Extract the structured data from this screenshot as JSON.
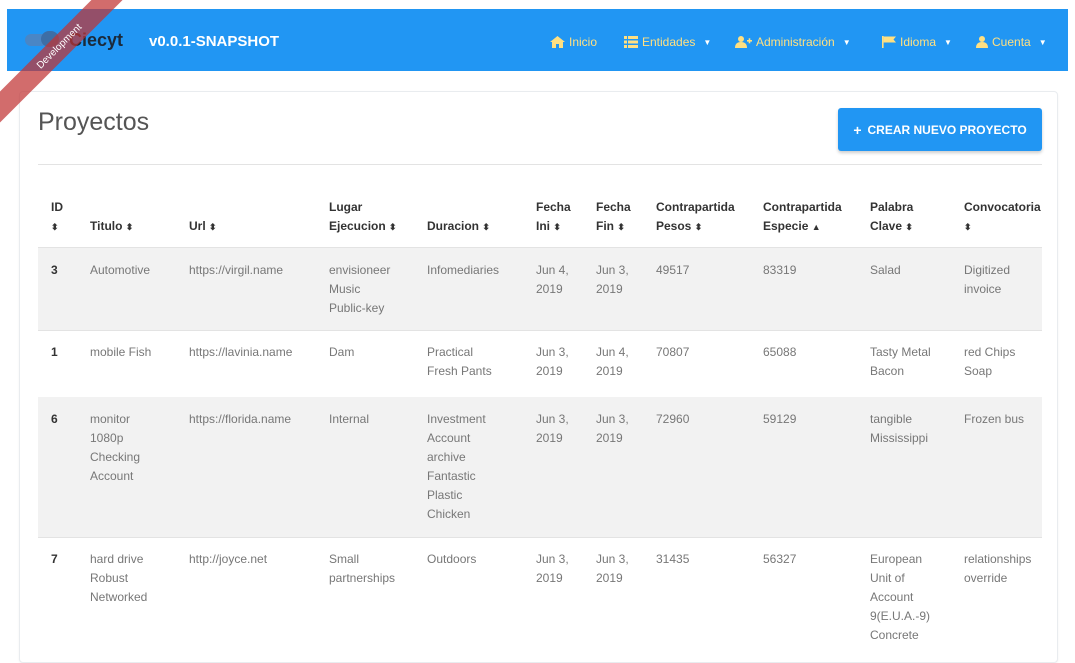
{
  "app": {
    "brand_name": "Ciecyt",
    "version": "v0.0.1-SNAPSHOT",
    "ribbon": "Development"
  },
  "nav": [
    {
      "label": "Inicio",
      "icon": "home-icon"
    },
    {
      "label": "Entidades",
      "icon": "list-icon"
    },
    {
      "label": "Administración",
      "icon": "user-add-icon"
    },
    {
      "label": "Idioma",
      "icon": "flag-icon"
    },
    {
      "label": "Cuenta",
      "icon": "user-icon"
    }
  ],
  "page": {
    "title": "Proyectos",
    "create_button": "CREAR NUEVO PROYECTO"
  },
  "table": {
    "headers": [
      {
        "l1": "ID",
        "l2": ""
      },
      {
        "l1": "Titulo",
        "l2": ""
      },
      {
        "l1": "Url",
        "l2": ""
      },
      {
        "l1": "Lugar",
        "l2": "Ejecucion"
      },
      {
        "l1": "Duracion",
        "l2": ""
      },
      {
        "l1": "Fecha",
        "l2": "Ini"
      },
      {
        "l1": "Fecha",
        "l2": "Fin"
      },
      {
        "l1": "Contrapartida",
        "l2": "Pesos"
      },
      {
        "l1": "Contrapartida",
        "l2": "Especie"
      },
      {
        "l1": "Palabra",
        "l2": "Clave"
      },
      {
        "l1": "Convocatoria",
        "l2": ""
      }
    ],
    "rows": [
      {
        "id": "3",
        "titulo": "Automotive",
        "url": "https://virgil.name",
        "lugar": "envisioneer\nMusic\nPublic-key",
        "duracion": "Infomediaries",
        "fecha_ini": "Jun 4,\n2019",
        "fecha_fin": "Jun 3,\n2019",
        "pesos": "49517",
        "especie": "83319",
        "clave": "Salad",
        "convocatoria": "Digitized\ninvoice"
      },
      {
        "id": "1",
        "titulo": "mobile Fish",
        "url": "https://lavinia.name",
        "lugar": "Dam",
        "duracion": "Practical\nFresh Pants",
        "fecha_ini": "Jun 3,\n2019",
        "fecha_fin": "Jun 4,\n2019",
        "pesos": "70807",
        "especie": "65088",
        "clave": "Tasty Metal\nBacon",
        "convocatoria": "red Chips\nSoap"
      },
      {
        "id": "6",
        "titulo": "monitor\n1080p\nChecking\nAccount",
        "url": "https://florida.name",
        "lugar": "Internal",
        "duracion": "Investment\nAccount\narchive\nFantastic\nPlastic\nChicken",
        "fecha_ini": "Jun 3,\n2019",
        "fecha_fin": "Jun 3,\n2019",
        "pesos": "72960",
        "especie": "59129",
        "clave": "tangible\nMississippi",
        "convocatoria": "Frozen bus"
      },
      {
        "id": "7",
        "titulo": "hard drive\nRobust\nNetworked",
        "url": "http://joyce.net",
        "lugar": "Small\npartnerships",
        "duracion": "Outdoors",
        "fecha_ini": "Jun 3,\n2019",
        "fecha_fin": "Jun 3,\n2019",
        "pesos": "31435",
        "especie": "56327",
        "clave": "European\nUnit of\nAccount\n9(E.U.A.-9)\nConcrete",
        "convocatoria": "relationships\noverride"
      }
    ]
  }
}
